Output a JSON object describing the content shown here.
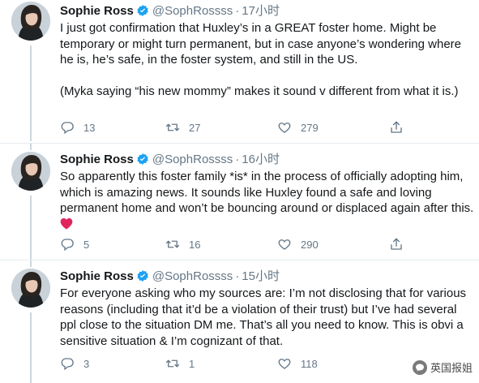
{
  "account": {
    "name": "Sophie Ross",
    "handle": "@SophRossss",
    "verified": true
  },
  "separator": "·",
  "tweets": [
    {
      "time": "17小时",
      "paragraphs": [
        "I just got confirmation that Huxley’s in a GREAT foster home. Might be temporary or might turn permanent, but in case anyone’s wondering where he is, he’s safe, in the foster system, and still in the US.",
        "(Myka saying “his new mommy” makes it sound v different from what it is.)"
      ],
      "replies": "13",
      "retweets": "27",
      "likes": "279"
    },
    {
      "time": "16小时",
      "paragraphs": [
        "So apparently this foster family *is* in the process of officially adopting him, which is amazing news. It sounds like Huxley found a safe and loving permanent home and won’t be bouncing around or displaced again after this."
      ],
      "emoji": "red-heart",
      "replies": "5",
      "retweets": "16",
      "likes": "290"
    },
    {
      "time": "15小时",
      "paragraphs": [
        "For everyone asking who my sources are: I’m not disclosing that for various reasons (including that it’d be a violation of their trust) but I’ve had several ppl close to the situation DM me. That’s all you need to know. This is obvi a sensitive situation & I’m cognizant of that."
      ],
      "replies": "3",
      "retweets": "1",
      "likes": "118"
    }
  ],
  "watermark": "英国报姐",
  "colors": {
    "text": "#14171a",
    "secondary": "#657786",
    "verified": "#1da1f2",
    "divider": "#e6ecf0",
    "heart": "#e0245e"
  }
}
